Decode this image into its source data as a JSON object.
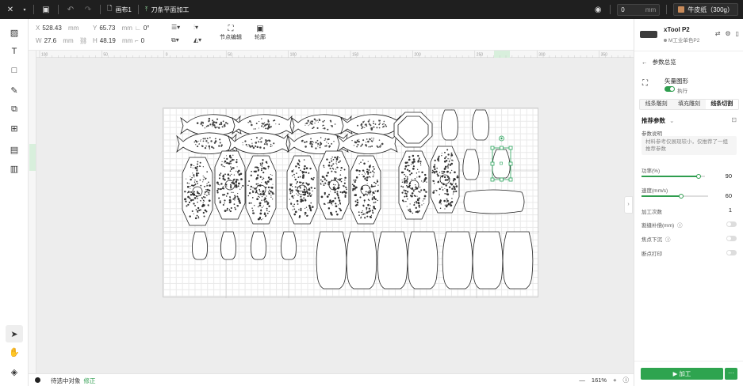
{
  "topbar": {
    "canvas_tab": "画布1",
    "process_tab": "刀条平面加工",
    "zoom_value": "0",
    "zoom_unit": "mm",
    "material": "牛皮纸（300g）"
  },
  "props": {
    "x_label": "X",
    "x_value": "528.43",
    "x_unit": "mm",
    "y_label": "Y",
    "y_value": "65.73",
    "y_unit": "mm",
    "angle_value": "0°",
    "w_label": "W",
    "w_value": "27.6",
    "w_unit": "mm",
    "h_label": "H",
    "h_value": "48.19",
    "h_unit": "mm",
    "corner_value": "0",
    "node_edit": "节点编辑",
    "outline": "轮廓"
  },
  "rulers": {
    "ticks": [
      "100",
      "50",
      "0",
      "50",
      "100",
      "150",
      "200",
      "250",
      "300",
      "350",
      "400"
    ]
  },
  "status": {
    "selection": "待选中对象",
    "selection_link": "修正",
    "zoom": "161%"
  },
  "panel": {
    "device_name": "xTool P2",
    "device_status": "M工业单色P2",
    "back_label": "参数总览",
    "layer_name": "矢量图形",
    "layer_state": "执行",
    "tabs": [
      "线条雕刻",
      "填充雕刻",
      "线条切割"
    ],
    "active_tab": 2,
    "preset_label": "推荐参数",
    "param_desc_label": "参数说明",
    "param_desc": "材料参考仅展现较小，仅推荐了一组推荐参数",
    "power_label": "功率(%)",
    "power_value": 90,
    "speed_label": "速度(mm/s)",
    "speed_value": 60,
    "passes_label": "加工次数",
    "passes_value": "1",
    "kerf_label": "割缝补偿(mm)",
    "focus_label": "焦点下沉",
    "breakpoint_label": "断点打印",
    "process_button": "加工",
    "more_button": "···"
  },
  "colors": {
    "accent": "#2ea44f",
    "topbar": "#1f1f1f",
    "selection": "#29a35a"
  }
}
